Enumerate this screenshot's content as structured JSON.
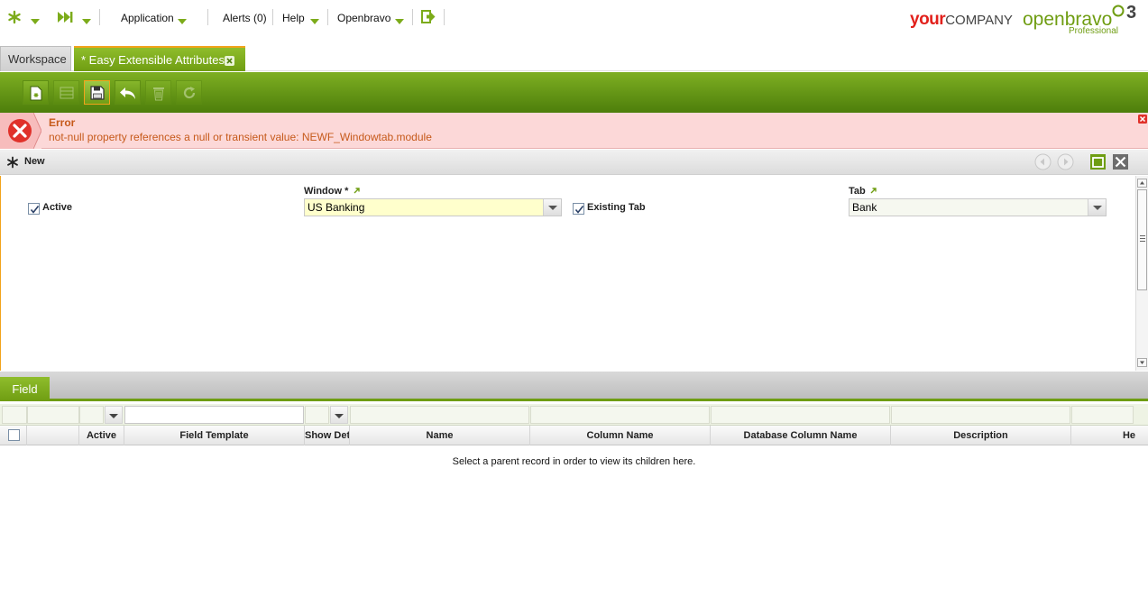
{
  "topbar": {
    "application_label": "Application",
    "alerts_label": "Alerts (0)",
    "help_label": "Help",
    "openbravo_label": "Openbravo",
    "brand_your": "your",
    "brand_company": "COMPANY",
    "brand_openbravo": "openbravo",
    "brand_edition": "Professional",
    "brand_version": "3"
  },
  "tabs": {
    "workspace": "Workspace",
    "active": "* Easy Extensible Attributes"
  },
  "error": {
    "title": "Error",
    "message": "not-null property references a null or transient value: NEWF_Windowtab.module"
  },
  "record_bar": {
    "label": "New"
  },
  "form": {
    "active_label": "Active",
    "window_label": "Window *",
    "window_value": "US Banking",
    "existing_tab_label": "Existing Tab",
    "tab_label": "Tab",
    "tab_value": "Bank"
  },
  "child": {
    "tab_label": "Field",
    "columns": [
      "Active",
      "Field Template",
      "Show Det",
      "Name",
      "Column Name",
      "Database Column Name",
      "Description",
      "He"
    ],
    "empty_message": "Select a parent record in order to view its children here."
  },
  "colors": {
    "accent_green": "#6f9d12",
    "accent_orange": "#f2a31b",
    "error_bg": "#fcd8d8",
    "error_text": "#c65a1b",
    "brand_red": "#e2211c"
  }
}
